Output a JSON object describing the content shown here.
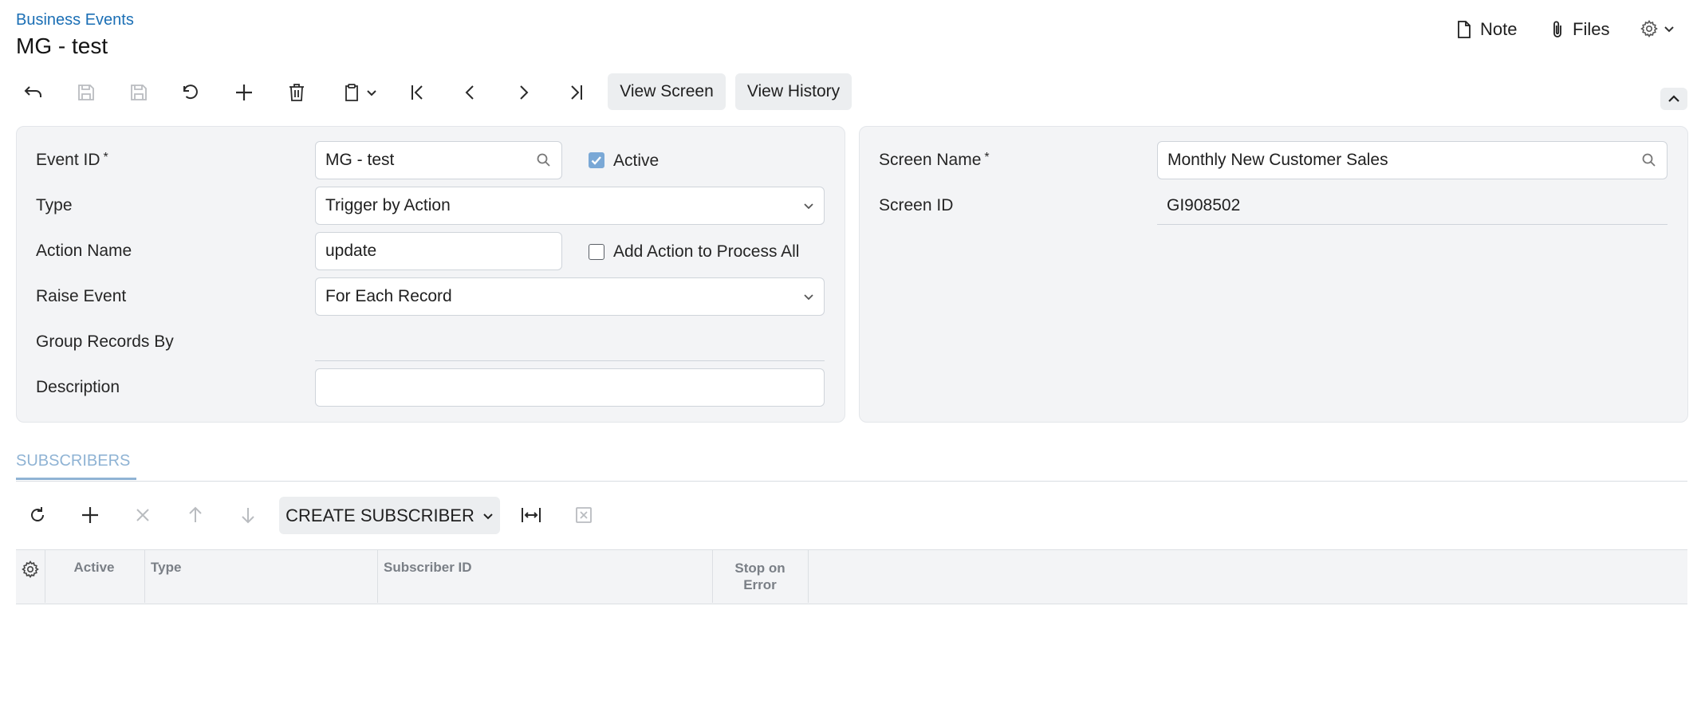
{
  "breadcrumb": "Business Events",
  "page_title": "MG - test",
  "top_actions": {
    "note": "Note",
    "files": "Files"
  },
  "toolbar": {
    "view_screen": "View Screen",
    "view_history": "View History"
  },
  "form": {
    "event_id": {
      "label": "Event ID",
      "required": "*",
      "value": "MG - test"
    },
    "active": {
      "label": "Active",
      "checked": true
    },
    "type": {
      "label": "Type",
      "value": "Trigger by Action"
    },
    "action_name": {
      "label": "Action Name",
      "value": "update"
    },
    "add_action": {
      "label": "Add Action to Process All",
      "checked": false
    },
    "raise_event": {
      "label": "Raise Event",
      "value": "For Each Record"
    },
    "group_records_by": {
      "label": "Group Records By",
      "value": ""
    },
    "description": {
      "label": "Description",
      "value": ""
    }
  },
  "screen": {
    "screen_name": {
      "label": "Screen Name",
      "required": "*",
      "value": "Monthly New Customer Sales"
    },
    "screen_id": {
      "label": "Screen ID",
      "value": "GI908502"
    }
  },
  "tabs": [
    {
      "label": "SUBSCRIBERS"
    }
  ],
  "grid": {
    "create_subscriber": "CREATE SUBSCRIBER",
    "columns": [
      "Active",
      "Type",
      "Subscriber ID",
      "Stop on Error"
    ]
  },
  "colors": {
    "link": "#1b6fb5",
    "tab_active": "#8fb3d4",
    "panel_bg": "#f3f4f6",
    "checkbox_on": "#7aa8d6"
  }
}
